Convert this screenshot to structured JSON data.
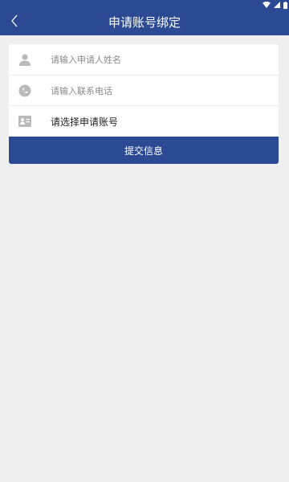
{
  "status_bar": {
    "icons": [
      "wifi-icon",
      "signal-icon",
      "battery-icon"
    ]
  },
  "header": {
    "title": "申请账号绑定",
    "back_icon": "chevron-left-icon",
    "background_color": "#2b4a93"
  },
  "form": {
    "name_field": {
      "icon": "person-icon",
      "placeholder": "请输入申请人姓名",
      "value": ""
    },
    "phone_field": {
      "icon": "phone-icon",
      "placeholder": "请输入联系电话",
      "value": ""
    },
    "account_select": {
      "icon": "id-card-icon",
      "label": "请选择申请账号"
    },
    "submit_label": "提交信息"
  },
  "colors": {
    "accent": "#2b4a93",
    "page_background": "#efefef",
    "icon_gray": "#b9b9b9"
  }
}
